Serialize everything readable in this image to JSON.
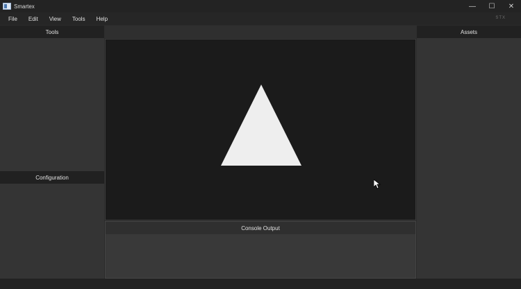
{
  "app": {
    "title": "Smartex",
    "brand": "STX"
  },
  "window_controls": {
    "minimize": "—",
    "maximize": "☐",
    "close": "✕"
  },
  "menu": [
    "File",
    "Edit",
    "View",
    "Tools",
    "Help"
  ],
  "panels": {
    "tools": "Tools",
    "configuration": "Configuration",
    "assets": "Assets",
    "console": "Console Output"
  },
  "viewport": {
    "shape": "triangle",
    "fill_color": "#eeeeee",
    "background_color": "#1b1b1b"
  }
}
